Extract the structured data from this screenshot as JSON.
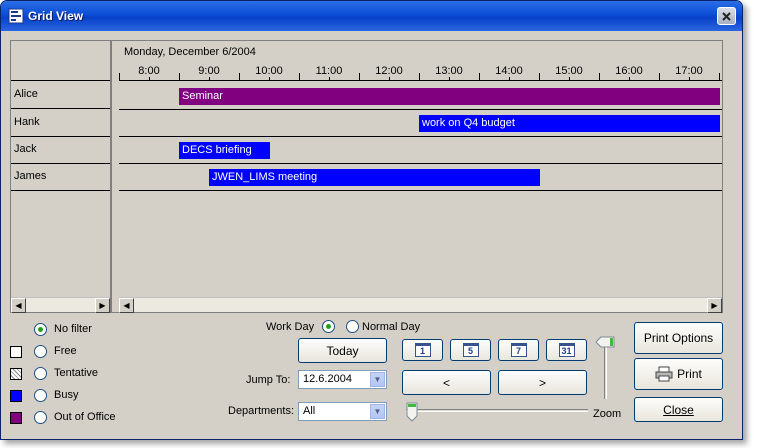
{
  "window": {
    "title": "Grid View"
  },
  "grid": {
    "date": "Monday, December 6/2004",
    "hours": [
      "8:00",
      "9:00",
      "10:00",
      "11:00",
      "12:00",
      "13:00",
      "14:00",
      "15:00",
      "16:00",
      "17:00"
    ],
    "rows": [
      {
        "name": "Alice",
        "events": [
          {
            "label": "Seminar",
            "status": "Out of Office",
            "start": "8:30",
            "end": "17:30"
          }
        ]
      },
      {
        "name": "Hank",
        "events": [
          {
            "label": "work on Q4 budget",
            "status": "Busy",
            "start": "12:30",
            "end": "17:30"
          }
        ]
      },
      {
        "name": "Jack",
        "events": [
          {
            "label": "DECS briefing",
            "status": "Busy",
            "start": "8:30",
            "end": "10:00"
          }
        ]
      },
      {
        "name": "James",
        "events": [
          {
            "label": "JWEN_LIMS meeting",
            "status": "Busy",
            "start": "9:00",
            "end": "14:30"
          }
        ]
      }
    ]
  },
  "legend": [
    {
      "label": "No filter",
      "selected": true,
      "swatch": ""
    },
    {
      "label": "Free",
      "selected": false,
      "swatch": "#ffffff"
    },
    {
      "label": "Tentative",
      "selected": false,
      "swatch": "hatched"
    },
    {
      "label": "Busy",
      "selected": false,
      "swatch": "#0000ff"
    },
    {
      "label": "Out of Office",
      "selected": false,
      "swatch": "#800080"
    }
  ],
  "view_mode": {
    "work_day": "Work Day",
    "normal_day": "Normal Day",
    "selected": "work_day"
  },
  "controls": {
    "today": "Today",
    "jump_to_label": "Jump To:",
    "jump_to_value": "12.6.2004",
    "departments_label": "Departments:",
    "departments_value": "All",
    "zoom_label": "Zoom",
    "day_icons": [
      "1",
      "5",
      "7",
      "31"
    ],
    "prev": "<",
    "next": ">"
  },
  "actions": {
    "print_options": "Print Options",
    "print": "Print",
    "close": "Close"
  },
  "colors": {
    "busy": "#0000ff",
    "out_of_office": "#800080"
  }
}
